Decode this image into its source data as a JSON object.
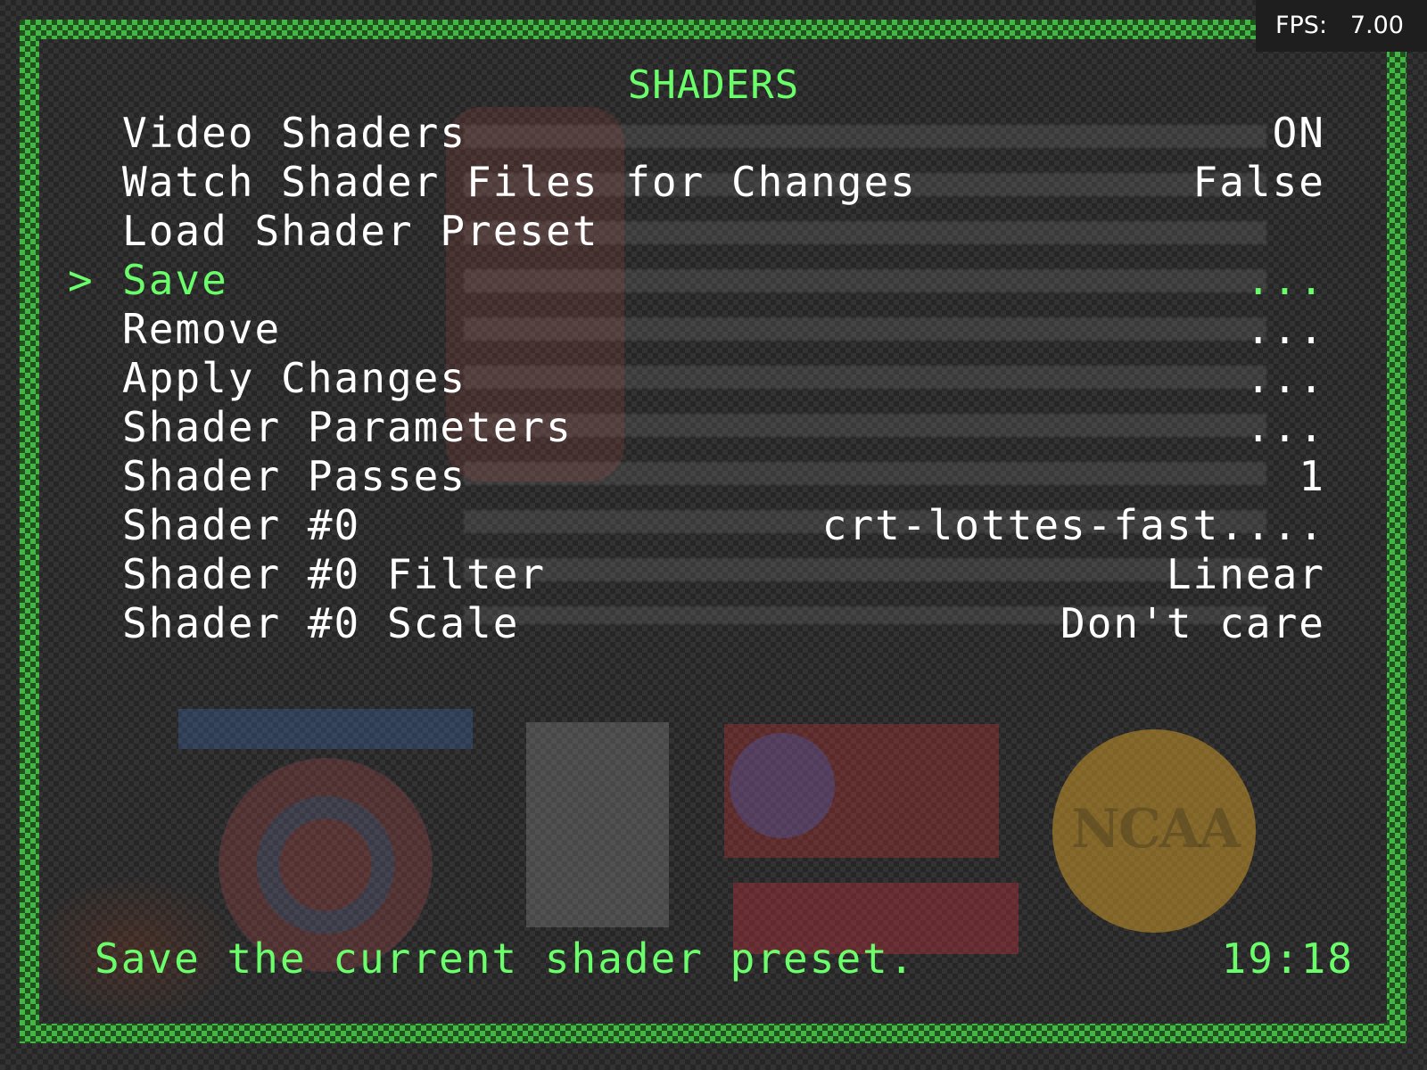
{
  "hud": {
    "fps_label": "FPS:",
    "fps_value": "7.00"
  },
  "menu": {
    "title": "SHADERS",
    "cursor": ">",
    "items": [
      {
        "label": "Video Shaders",
        "value": "ON"
      },
      {
        "label": "Watch Shader Files for Changes",
        "value": "False"
      },
      {
        "label": "Load Shader Preset",
        "value": ""
      },
      {
        "label": "Save",
        "value": "...",
        "selected": true
      },
      {
        "label": "Remove",
        "value": "..."
      },
      {
        "label": "Apply Changes",
        "value": "..."
      },
      {
        "label": "Shader Parameters",
        "value": "..."
      },
      {
        "label": "Shader Passes",
        "value": "1"
      },
      {
        "label": "Shader #0",
        "value": "crt-lottes-fast...."
      },
      {
        "label": "Shader #0 Filter",
        "value": "Linear"
      },
      {
        "label": "Shader #0 Scale",
        "value": "Don't care"
      }
    ]
  },
  "footer": {
    "sublabel": "Save the current shader preset.",
    "clock": "19:18"
  },
  "background": {
    "logo_text": "NCAA"
  },
  "colors": {
    "accent": "#6aff6a",
    "text": "#ffffff",
    "border": "#3fa43f"
  }
}
